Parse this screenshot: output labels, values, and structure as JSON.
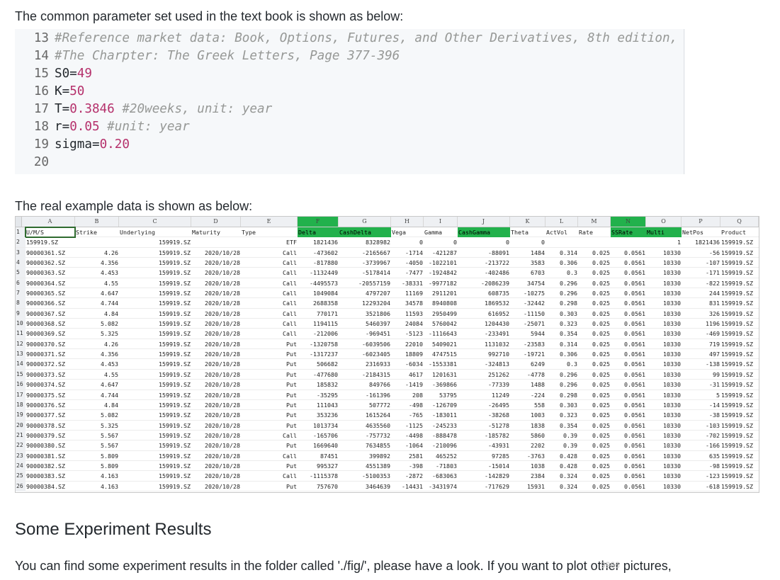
{
  "intro_text": "The common parameter set used in the text book is shown as below:",
  "code_lines": [
    {
      "n": "13",
      "segs": [
        {
          "t": "#Reference market data: Book, Options, Futures, and Other Derivatives, 8th edition,",
          "c": "cmt"
        }
      ]
    },
    {
      "n": "14",
      "segs": [
        {
          "t": "#The Charpter: The Greek Letters, Page 377-396",
          "c": "cmt"
        }
      ]
    },
    {
      "n": "15",
      "segs": [
        {
          "t": "S0=",
          "c": ""
        },
        {
          "t": "49",
          "c": "num"
        }
      ]
    },
    {
      "n": "16",
      "segs": [
        {
          "t": "K=",
          "c": ""
        },
        {
          "t": "50",
          "c": "num"
        }
      ]
    },
    {
      "n": "17",
      "segs": [
        {
          "t": "T=",
          "c": ""
        },
        {
          "t": "0.3846",
          "c": "num"
        },
        {
          "t": " ",
          "c": ""
        },
        {
          "t": "#20weeks, unit: year",
          "c": "cmt"
        }
      ]
    },
    {
      "n": "18",
      "segs": [
        {
          "t": "r=",
          "c": ""
        },
        {
          "t": "0.05",
          "c": "num"
        },
        {
          "t": " ",
          "c": ""
        },
        {
          "t": "#unit: year",
          "c": "cmt"
        }
      ]
    },
    {
      "n": "19",
      "segs": [
        {
          "t": "sigma=",
          "c": ""
        },
        {
          "t": "0.20",
          "c": "num"
        }
      ]
    },
    {
      "n": "20",
      "segs": []
    }
  ],
  "real_example_text": "The real example data is shown as below:",
  "sheet": {
    "col_letters": [
      "A",
      "B",
      "C",
      "D",
      "E",
      "F",
      "G",
      "H",
      "I",
      "J",
      "K",
      "L",
      "M",
      "N",
      "O",
      "P",
      "Q"
    ],
    "green_letters": [
      "F",
      "N"
    ],
    "header_row": [
      "U/M/S",
      "Strike",
      "Underlying",
      "Maturity",
      "Type",
      "Delta",
      "CashDelta",
      "Vega",
      "Gamma",
      "CashGamma",
      "Theta",
      "ActVol",
      "Rate",
      "SSRate",
      "Multi",
      "NetPos",
      "Product"
    ],
    "green_headers": [
      "Delta",
      "CashDelta",
      "CashGamma",
      "SSRate",
      "Multi"
    ],
    "rows": [
      [
        "159919.SZ",
        "",
        "159919.SZ",
        "",
        "ETF",
        "1821436",
        "8328982",
        "0",
        "0",
        "0",
        "0",
        "",
        "",
        "",
        "1",
        "1821436",
        "159919.SZ"
      ],
      [
        "90000361.SZ",
        "4.26",
        "159919.SZ",
        "2020/10/28",
        "Call",
        "-473602",
        "-2165667",
        "-1714",
        "-421287",
        "-88091",
        "1484",
        "0.314",
        "0.025",
        "0.0561",
        "10330",
        "-56",
        "159919.SZ"
      ],
      [
        "90000362.SZ",
        "4.356",
        "159919.SZ",
        "2020/10/28",
        "Call",
        "-817880",
        "-3739967",
        "-4050",
        "-1022101",
        "-213722",
        "3583",
        "0.306",
        "0.025",
        "0.0561",
        "10330",
        "-107",
        "159919.SZ"
      ],
      [
        "90000363.SZ",
        "4.453",
        "159919.SZ",
        "2020/10/28",
        "Call",
        "-1132449",
        "-5178414",
        "-7477",
        "-1924842",
        "-402486",
        "6703",
        "0.3",
        "0.025",
        "0.0561",
        "10330",
        "-171",
        "159919.SZ"
      ],
      [
        "90000364.SZ",
        "4.55",
        "159919.SZ",
        "2020/10/28",
        "Call",
        "-4495573",
        "-20557159",
        "-38331",
        "-9977182",
        "-2086239",
        "34754",
        "0.296",
        "0.025",
        "0.0561",
        "10330",
        "-822",
        "159919.SZ"
      ],
      [
        "90000365.SZ",
        "4.647",
        "159919.SZ",
        "2020/10/28",
        "Call",
        "1049084",
        "4797207",
        "11169",
        "2911201",
        "608735",
        "-10275",
        "0.296",
        "0.025",
        "0.0561",
        "10330",
        "244",
        "159919.SZ"
      ],
      [
        "90000366.SZ",
        "4.744",
        "159919.SZ",
        "2020/10/28",
        "Call",
        "2688358",
        "12293204",
        "34578",
        "8940808",
        "1869532",
        "-32442",
        "0.298",
        "0.025",
        "0.0561",
        "10330",
        "831",
        "159919.SZ"
      ],
      [
        "90000367.SZ",
        "4.84",
        "159919.SZ",
        "2020/10/28",
        "Call",
        "770171",
        "3521806",
        "11593",
        "2950499",
        "616952",
        "-11150",
        "0.303",
        "0.025",
        "0.0561",
        "10330",
        "326",
        "159919.SZ"
      ],
      [
        "90000368.SZ",
        "5.082",
        "159919.SZ",
        "2020/10/28",
        "Call",
        "1194115",
        "5460397",
        "24084",
        "5760042",
        "1204430",
        "-25071",
        "0.323",
        "0.025",
        "0.0561",
        "10330",
        "1196",
        "159919.SZ"
      ],
      [
        "90000369.SZ",
        "5.325",
        "159919.SZ",
        "2020/10/28",
        "Call",
        "-212006",
        "-969451",
        "-5123",
        "-1116643",
        "-233491",
        "5944",
        "0.354",
        "0.025",
        "0.0561",
        "10330",
        "-469",
        "159919.SZ"
      ],
      [
        "90000370.SZ",
        "4.26",
        "159919.SZ",
        "2020/10/28",
        "Put",
        "-1320758",
        "-6039506",
        "22010",
        "5409021",
        "1131032",
        "-23583",
        "0.314",
        "0.025",
        "0.0561",
        "10330",
        "719",
        "159919.SZ"
      ],
      [
        "90000371.SZ",
        "4.356",
        "159919.SZ",
        "2020/10/28",
        "Put",
        "-1317237",
        "-6023405",
        "18809",
        "4747515",
        "992710",
        "-19721",
        "0.306",
        "0.025",
        "0.0561",
        "10330",
        "497",
        "159919.SZ"
      ],
      [
        "90000372.SZ",
        "4.453",
        "159919.SZ",
        "2020/10/28",
        "Put",
        "506682",
        "2316933",
        "-6034",
        "-1553381",
        "-324813",
        "6249",
        "0.3",
        "0.025",
        "0.0561",
        "10330",
        "-138",
        "159919.SZ"
      ],
      [
        "90000373.SZ",
        "4.55",
        "159919.SZ",
        "2020/10/28",
        "Put",
        "-477680",
        "-2184315",
        "4617",
        "1201631",
        "251262",
        "-4778",
        "0.296",
        "0.025",
        "0.0561",
        "10330",
        "99",
        "159919.SZ"
      ],
      [
        "90000374.SZ",
        "4.647",
        "159919.SZ",
        "2020/10/28",
        "Put",
        "185832",
        "849766",
        "-1419",
        "-369866",
        "-77339",
        "1488",
        "0.296",
        "0.025",
        "0.0561",
        "10330",
        "-31",
        "159919.SZ"
      ],
      [
        "90000375.SZ",
        "4.744",
        "159919.SZ",
        "2020/10/28",
        "Put",
        "-35295",
        "-161396",
        "208",
        "53795",
        "11249",
        "-224",
        "0.298",
        "0.025",
        "0.0561",
        "10330",
        "5",
        "159919.SZ"
      ],
      [
        "90000376.SZ",
        "4.84",
        "159919.SZ",
        "2020/10/28",
        "Put",
        "111043",
        "507772",
        "-498",
        "-126709",
        "-26495",
        "558",
        "0.303",
        "0.025",
        "0.0561",
        "10330",
        "-14",
        "159919.SZ"
      ],
      [
        "90000377.SZ",
        "5.082",
        "159919.SZ",
        "2020/10/28",
        "Put",
        "353236",
        "1615264",
        "-765",
        "-183011",
        "-38268",
        "1003",
        "0.323",
        "0.025",
        "0.0561",
        "10330",
        "-38",
        "159919.SZ"
      ],
      [
        "90000378.SZ",
        "5.325",
        "159919.SZ",
        "2020/10/28",
        "Put",
        "1013734",
        "4635560",
        "-1125",
        "-245233",
        "-51278",
        "1838",
        "0.354",
        "0.025",
        "0.0561",
        "10330",
        "-103",
        "159919.SZ"
      ],
      [
        "90000379.SZ",
        "5.567",
        "159919.SZ",
        "2020/10/28",
        "Call",
        "-165706",
        "-757732",
        "-4498",
        "-888478",
        "-185782",
        "5860",
        "0.39",
        "0.025",
        "0.0561",
        "10330",
        "-702",
        "159919.SZ"
      ],
      [
        "90000380.SZ",
        "5.567",
        "159919.SZ",
        "2020/10/28",
        "Put",
        "1669640",
        "7634855",
        "-1064",
        "-210096",
        "-43931",
        "2202",
        "0.39",
        "0.025",
        "0.0561",
        "10330",
        "-166",
        "159919.SZ"
      ],
      [
        "90000381.SZ",
        "5.809",
        "159919.SZ",
        "2020/10/28",
        "Call",
        "87451",
        "399892",
        "2581",
        "465252",
        "97285",
        "-3763",
        "0.428",
        "0.025",
        "0.0561",
        "10330",
        "635",
        "159919.SZ"
      ],
      [
        "90000382.SZ",
        "5.809",
        "159919.SZ",
        "2020/10/28",
        "Put",
        "995327",
        "4551389",
        "-398",
        "-71803",
        "-15014",
        "1038",
        "0.428",
        "0.025",
        "0.0561",
        "10330",
        "-98",
        "159919.SZ"
      ],
      [
        "90000383.SZ",
        "4.163",
        "159919.SZ",
        "2020/10/28",
        "Call",
        "-1115378",
        "-5100353",
        "-2872",
        "-683063",
        "-142829",
        "2384",
        "0.324",
        "0.025",
        "0.0561",
        "10330",
        "-123",
        "159919.SZ"
      ],
      [
        "90000384.SZ",
        "4.163",
        "159919.SZ",
        "2020/10/28",
        "Put",
        "757670",
        "3464639",
        "-14431",
        "-3431974",
        "-717629",
        "15931",
        "0.324",
        "0.025",
        "0.0561",
        "10330",
        "-618",
        "159919.SZ"
      ]
    ]
  },
  "experiment_heading": "Some Experiment Results",
  "experiment_text": "You can find some experiment results in the folder called './fig/', please have a look. If you want to plot other pictures,",
  "watermark_text": "9966"
}
